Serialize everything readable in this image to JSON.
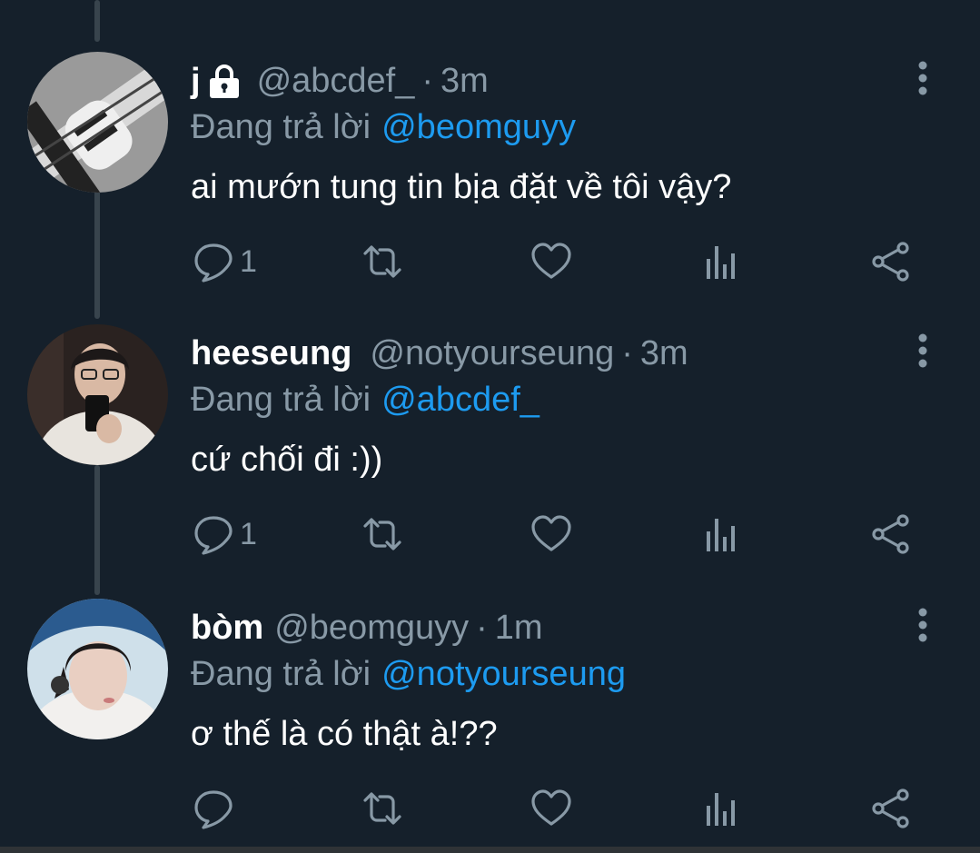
{
  "replying_prefix": "Đang trả lời",
  "tweets": [
    {
      "name": "j",
      "handle": "@abcdef_",
      "separator": "·",
      "time": "3m",
      "reply_to": "@beomguyy",
      "text": "ai mướn tung tin bịa đặt về tôi vậy?",
      "reply_count": "1",
      "protected": true
    },
    {
      "name": "heeseung",
      "handle": "@notyourseung",
      "separator": "·",
      "time": "3m",
      "reply_to": "@abcdef_",
      "text": "cứ chối đi :))",
      "reply_count": "1",
      "protected": false
    },
    {
      "name": "bòm",
      "handle": "@beomguyy",
      "separator": "·",
      "time": "1m",
      "reply_to": "@notyourseung",
      "text": "ơ thế là có thật à!??",
      "reply_count": "",
      "protected": false
    }
  ],
  "icons": {
    "reply": "speech-bubble-icon",
    "retweet": "retweet-icon",
    "like": "heart-icon",
    "analytics": "bar-chart-icon",
    "share": "share-icon",
    "more": "vertical-dots-icon",
    "lock": "lock-icon"
  },
  "colors": {
    "background": "#15202b",
    "text": "#ffffff",
    "secondary": "#8899a6",
    "link": "#1d9bf0",
    "thread_line": "#38444d"
  }
}
